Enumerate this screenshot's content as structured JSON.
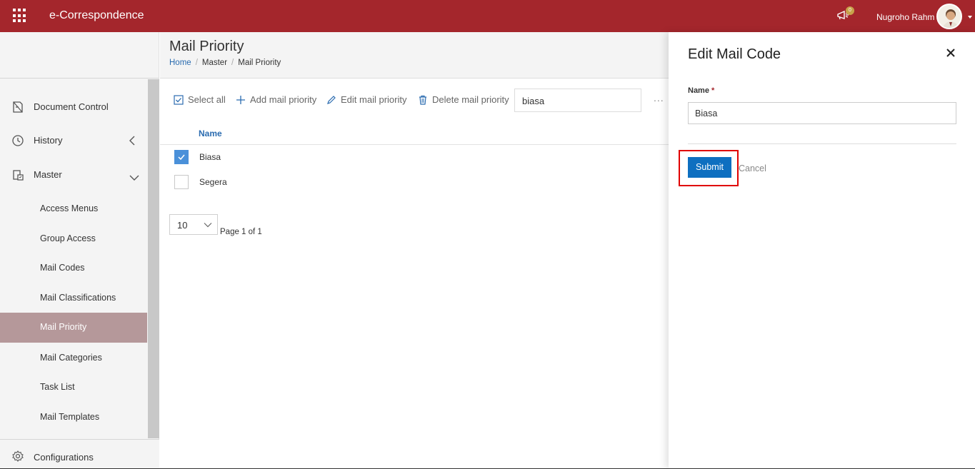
{
  "app": {
    "title": "e-Correspondence",
    "notification_count": "0",
    "user_name": "Nugroho Rahm"
  },
  "sidebar": {
    "items": [
      {
        "label": "Document Control",
        "icon": "document-control-icon"
      },
      {
        "label": "History",
        "icon": "history-icon"
      },
      {
        "label": "Master",
        "icon": "master-icon"
      }
    ],
    "master_items": [
      {
        "label": "Access Menus"
      },
      {
        "label": "Group Access"
      },
      {
        "label": "Mail Codes"
      },
      {
        "label": "Mail Classifications"
      },
      {
        "label": "Mail Priority",
        "active": true
      },
      {
        "label": "Mail Categories"
      },
      {
        "label": "Task List"
      },
      {
        "label": "Mail Templates"
      }
    ],
    "config_label": "Configurations"
  },
  "page": {
    "title": "Mail Priority",
    "breadcrumb": [
      "Home",
      "Master",
      "Mail Priority"
    ]
  },
  "toolbar": {
    "select_all": "Select all",
    "add": "Add mail priority",
    "edit": "Edit mail priority",
    "delete": "Delete mail priority",
    "search_value": "biasa",
    "more": "..."
  },
  "list": {
    "column_name": "Name",
    "rows": [
      {
        "name": "Biasa",
        "checked": true
      },
      {
        "name": "Segera",
        "checked": false
      }
    ],
    "page_size": "10",
    "page_info": "Page 1 of 1"
  },
  "panel": {
    "title": "Edit Mail Code",
    "field_label": "Name",
    "required_mark": "*",
    "field_value": "Biasa",
    "submit": "Submit",
    "cancel": "Cancel"
  },
  "colors": {
    "brand": "#a4262c",
    "primary": "#0e6fc0",
    "active_nav": "#b5989a",
    "highlight": "#e00000"
  }
}
